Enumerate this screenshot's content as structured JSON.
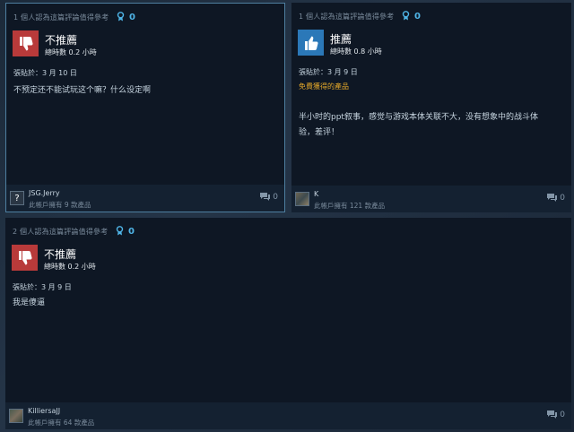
{
  "colors": {
    "background": "#1b2838",
    "card": "#0e1724",
    "footer": "#142131",
    "thumb_down": "#b83a3a",
    "thumb_up": "#2b78b8",
    "award_count": "#4fb4e6",
    "product_received": "#e4a82a"
  },
  "reviews": [
    {
      "helpful_text": "1 個人認為這篇評論值得參考",
      "award_count": "0",
      "verdict": "不推薦",
      "verdict_icon": "thumbs-down-icon",
      "hours": "總時數 0.2 小時",
      "posted": "張貼於：3 月 10 日",
      "received": "",
      "body": "不预定还不能试玩这个嘛？什么设定啊",
      "user": "JSG.Jerry",
      "owned": "此帳戶擁有 9 款產品",
      "avatar": "?",
      "comments": "0"
    },
    {
      "helpful_text": "1 個人認為這篇評論值得參考",
      "award_count": "0",
      "verdict": "推薦",
      "verdict_icon": "thumbs-up-icon",
      "hours": "總時數 0.8 小時",
      "posted": "張貼於：3 月 9 日",
      "received": "免費獲得的產品",
      "body": "半小时的ppt叙事，感觉与游戏本体关联不大，没有想象中的战斗体验，差评！",
      "user": "K",
      "owned": "此帳戶擁有 121 款產品",
      "avatar": "",
      "comments": "0"
    },
    {
      "helpful_text": "2 個人認為這篇評論值得參考",
      "award_count": "0",
      "verdict": "不推薦",
      "verdict_icon": "thumbs-down-icon",
      "hours": "總時數 0.2 小時",
      "posted": "張貼於：3 月 9 日",
      "received": "",
      "body": "我是傻逼",
      "user": "KilliersaJJ",
      "owned": "此帳戶擁有 64 款產品",
      "avatar": "",
      "comments": "0"
    }
  ]
}
